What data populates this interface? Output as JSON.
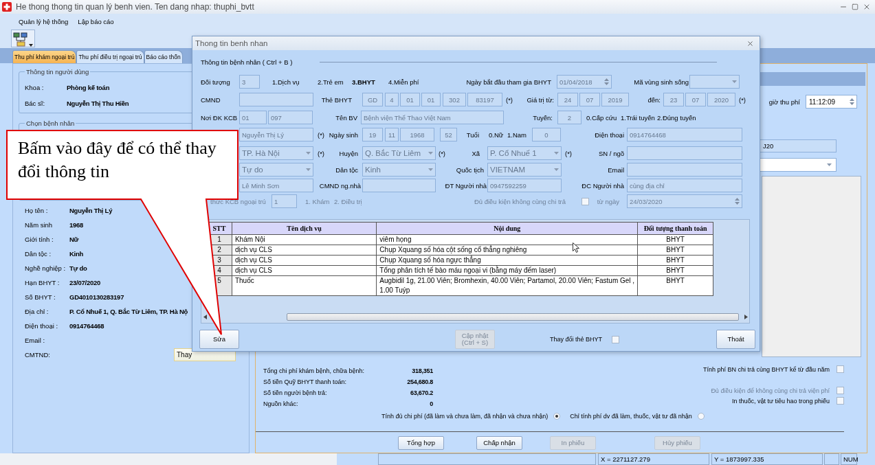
{
  "window": {
    "title": "He thong thong tin quan lý benh vien. Ten dang nhap: thuphi_bvtt"
  },
  "menu": [
    "Quản lý hệ thống",
    "Lập báo cáo"
  ],
  "tabs": [
    {
      "label": "Thu phí khám ngoại trú",
      "selected": true
    },
    {
      "label": "Thu phí điều trị ngoại trú",
      "selected": false
    },
    {
      "label": "Báo cáo thốn",
      "selected": false
    }
  ],
  "user_info": {
    "title": "Thông tin người dùng",
    "rows": [
      {
        "label": "Khoa :",
        "value": "Phòng kế toán"
      },
      {
        "label": "Bác sĩ:",
        "value": "Nguyễn Thị Thu Hiền"
      }
    ]
  },
  "patient_group": {
    "title": "Chọn bệnh nhân"
  },
  "patient_details": [
    {
      "label": "Họ tên :",
      "value": "Nguyễn Thị Lý"
    },
    {
      "label": "Năm sinh",
      "value": "1968"
    },
    {
      "label": "Giới tính :",
      "value": "Nữ"
    },
    {
      "label": "Dân tộc :",
      "value": "Kinh"
    },
    {
      "label": "Nghề nghiệp :",
      "value": "Tự do"
    },
    {
      "label": "Hạn BHYT :",
      "value": "23/07/2020"
    },
    {
      "label": "Số BHYT :",
      "value": "GD4010130283197"
    },
    {
      "label": "Địa chỉ :",
      "value": "P. Cổ Nhuế 1, Q. Bắc Từ Liêm, TP. Hà Nộ"
    },
    {
      "label": "Điện thoại :",
      "value": "0914764468"
    },
    {
      "label": "Email :"
    },
    {
      "label": "CMTND:",
      "button": "Thay"
    }
  ],
  "fee_time": {
    "label": "giờ thu phí",
    "value": "11:12:09"
  },
  "diagnosis": {
    "value": "J20"
  },
  "summary": {
    "totals": [
      {
        "label": "Tổng chi phí khám bệnh, chữa bệnh:",
        "value": "318,351"
      },
      {
        "label": "Số tiền Quỹ BHYT thanh toán:",
        "value": "254,680.8"
      },
      {
        "label": "Số tiền người bệnh trả:",
        "value": "63,670.2"
      },
      {
        "label": "Nguồn khác:",
        "value": "0"
      }
    ],
    "checkboxes": [
      {
        "label": "Tính phí BN chi trả cùng BHYT kể từ đầu năm",
        "checked": false,
        "disabled": false
      },
      {
        "label": "Đủ điều kiện để không cùng chi trả viện phí",
        "checked": false,
        "disabled": true
      },
      {
        "label": "In thuốc, vật tư tiêu hao trong phiếu",
        "checked": false,
        "disabled": false
      }
    ],
    "radios": [
      {
        "label": "Tính đủ chi phí (đã làm và chưa làm, đã nhận và chưa nhận)",
        "selected": true
      },
      {
        "label": "Chỉ tính phí dv đã làm, thuốc, vật tư đã nhận",
        "selected": false
      }
    ],
    "buttons": [
      {
        "label": "Tổng hợp",
        "disabled": false
      },
      {
        "label": "Chấp nhận",
        "disabled": false
      },
      {
        "label": "In phiếu",
        "disabled": true
      },
      {
        "label": "Hủy phiếu",
        "disabled": true
      }
    ]
  },
  "status_bar": [
    "X = 2271127.279",
    "Y = 1873997.335",
    "NUM"
  ],
  "dialog": {
    "title": "Thong tin benh nhan",
    "section": "Thông tin bệnh nhân ( Ctrl + B )",
    "rows": [
      {
        "disabled": false,
        "items": [
          {
            "kind": "label",
            "text": "Đối tượng"
          },
          {
            "kind": "field",
            "value": "3"
          },
          {
            "kind": "option",
            "text": "1.Dịch vụ",
            "selected": false
          },
          {
            "kind": "option",
            "text": "2.Trẻ em",
            "selected": false
          },
          {
            "kind": "option",
            "text": "3.BHYT",
            "selected": true
          },
          {
            "kind": "option",
            "text": "4.Miễn phí",
            "selected": false
          },
          {
            "kind": "label",
            "text": "Ngày bắt đầu tham gia BHYT"
          },
          {
            "kind": "spinner",
            "value": "01/04/2018"
          },
          {
            "kind": "label",
            "text": "Mã vùng sinh sống"
          },
          {
            "kind": "dropdown"
          }
        ]
      },
      {
        "disabled": false,
        "items": [
          {
            "kind": "label",
            "text": "CMND"
          },
          {
            "kind": "field"
          },
          {
            "kind": "label",
            "text": "Thẻ BHYT"
          },
          {
            "kind": "field",
            "value": "GD"
          },
          {
            "kind": "field",
            "value": "4"
          },
          {
            "kind": "field",
            "value": "01"
          },
          {
            "kind": "field",
            "value": "01"
          },
          {
            "kind": "field",
            "value": "302"
          },
          {
            "kind": "field",
            "value": "83197"
          },
          {
            "kind": "note",
            "text": "(*)"
          },
          {
            "kind": "label",
            "text": "Giá trị từ:"
          },
          {
            "kind": "field",
            "value": "24"
          },
          {
            "kind": "field",
            "value": "07"
          },
          {
            "kind": "field",
            "value": "2019"
          },
          {
            "kind": "label",
            "text": "đến:"
          },
          {
            "kind": "field",
            "value": "23"
          },
          {
            "kind": "field",
            "value": "07"
          },
          {
            "kind": "field",
            "value": "2020"
          },
          {
            "kind": "note",
            "text": "(*)"
          }
        ]
      },
      {
        "disabled": false,
        "items": [
          {
            "kind": "label",
            "text": "Nơi ĐK KCB"
          },
          {
            "kind": "field",
            "value": "01"
          },
          {
            "kind": "field",
            "value": "097"
          },
          {
            "kind": "label",
            "text": "Tên BV"
          },
          {
            "kind": "field",
            "value": "Bệnh viện Thể Thao Việt Nam"
          },
          {
            "kind": "label",
            "text": "Tuyến:"
          },
          {
            "kind": "field",
            "value": "2"
          },
          {
            "kind": "note",
            "text": "0.Cấp cứu"
          },
          {
            "kind": "note",
            "text": "1.Trái tuyến"
          },
          {
            "kind": "note",
            "text": "2.Đúng tuyến"
          }
        ]
      },
      {
        "disabled": false,
        "items": [
          {
            "kind": "field",
            "value": "Nguyễn Thị Lý"
          },
          {
            "kind": "note",
            "text": "(*)"
          },
          {
            "kind": "label",
            "text": "Ngày sinh"
          },
          {
            "kind": "field",
            "value": "19"
          },
          {
            "kind": "field",
            "value": "11"
          },
          {
            "kind": "field",
            "value": "1968"
          },
          {
            "kind": "field",
            "value": "52"
          },
          {
            "kind": "label",
            "text": "Tuổi"
          },
          {
            "kind": "note",
            "text": "0.Nữ"
          },
          {
            "kind": "note",
            "text": "1.Nam"
          },
          {
            "kind": "field",
            "value": "0"
          },
          {
            "kind": "label",
            "text": "Điện thoại"
          },
          {
            "kind": "field",
            "value": "0914764468"
          }
        ]
      },
      {
        "disabled": false,
        "items": [
          {
            "kind": "dropdown",
            "value": "TP. Hà Nội"
          },
          {
            "kind": "note",
            "text": "(*)"
          },
          {
            "kind": "label",
            "text": "Huyện"
          },
          {
            "kind": "dropdown",
            "value": "Q. Bắc Từ Liêm"
          },
          {
            "kind": "note",
            "text": "(*)"
          },
          {
            "kind": "label",
            "text": "Xã"
          },
          {
            "kind": "dropdown",
            "value": "P. Cổ Nhuế 1"
          },
          {
            "kind": "note",
            "text": "(*)"
          },
          {
            "kind": "label",
            "text": "SN / ngõ"
          },
          {
            "kind": "field"
          }
        ]
      },
      {
        "disabled": false,
        "items": [
          {
            "kind": "dropdown",
            "value": "Tự do"
          },
          {
            "kind": "label",
            "text": "Dân tộc"
          },
          {
            "kind": "dropdown",
            "value": "Kinh"
          },
          {
            "kind": "label",
            "text": "Quốc tịch"
          },
          {
            "kind": "dropdown",
            "value": "VIETNAM"
          },
          {
            "kind": "label",
            "text": "Email"
          },
          {
            "kind": "field"
          }
        ]
      },
      {
        "disabled": false,
        "items": [
          {
            "kind": "field",
            "value": "Lê Minh Sơn"
          },
          {
            "kind": "label",
            "text": "CMND ng.nhà"
          },
          {
            "kind": "field"
          },
          {
            "kind": "label",
            "text": "ĐT Người nhà"
          },
          {
            "kind": "field",
            "value": "0947592259"
          },
          {
            "kind": "label",
            "text": "ĐC Người nhà"
          },
          {
            "kind": "field",
            "value": "cùng địa chỉ"
          }
        ]
      },
      {
        "disabled": true,
        "items": [
          {
            "kind": "label",
            "text": "thức KCB ngoại trú"
          },
          {
            "kind": "field",
            "value": "1"
          },
          {
            "kind": "note",
            "text": "1. Khám"
          },
          {
            "kind": "note",
            "text": "2. Điều trị"
          },
          {
            "kind": "label",
            "text": "Đủ điều kiện không cùng chi trả"
          },
          {
            "kind": "checkbox",
            "checked": false
          },
          {
            "kind": "label",
            "text": "từ ngày"
          },
          {
            "kind": "spinner",
            "value": "24/03/2020"
          }
        ]
      }
    ],
    "table": {
      "columns": [
        "STT",
        "Tên dịch vụ",
        "Nội dung",
        "Đối tượng thanh toán"
      ],
      "rows": [
        [
          "1",
          "Khám Nội",
          "viêm họng",
          "BHYT"
        ],
        [
          "2",
          "dịch vụ CLS",
          "Chụp Xquang số hóa cột sống cổ thẳng nghiêng",
          "BHYT"
        ],
        [
          "3",
          "dịch vụ CLS",
          "Chụp Xquang số hóa ngực thẳng",
          "BHYT"
        ],
        [
          "4",
          "dịch vụ CLS",
          "Tổng phân tích tế bào máu ngoại vi (bằng máy đếm laser)",
          "BHYT"
        ],
        [
          "5",
          "Thuốc",
          "Augbidil 1g, 21.00 Viên; Bromhexin, 40.00 Viên; Partamol, 20.00 Viên; Fastum Gel , 1.00 Tuýp",
          "BHYT"
        ]
      ]
    },
    "buttons": [
      {
        "label": "Sửa",
        "disabled": false
      },
      {
        "label": "Cập nhật (Ctrl + S)",
        "disabled": true
      },
      {
        "label": "Thoát",
        "disabled": false
      }
    ],
    "change_card": {
      "label": "Thay đổi thẻ BHYT",
      "checked": false
    }
  },
  "callout": {
    "text": "Bấm vào đây để có thể thay đổi thông tin"
  }
}
